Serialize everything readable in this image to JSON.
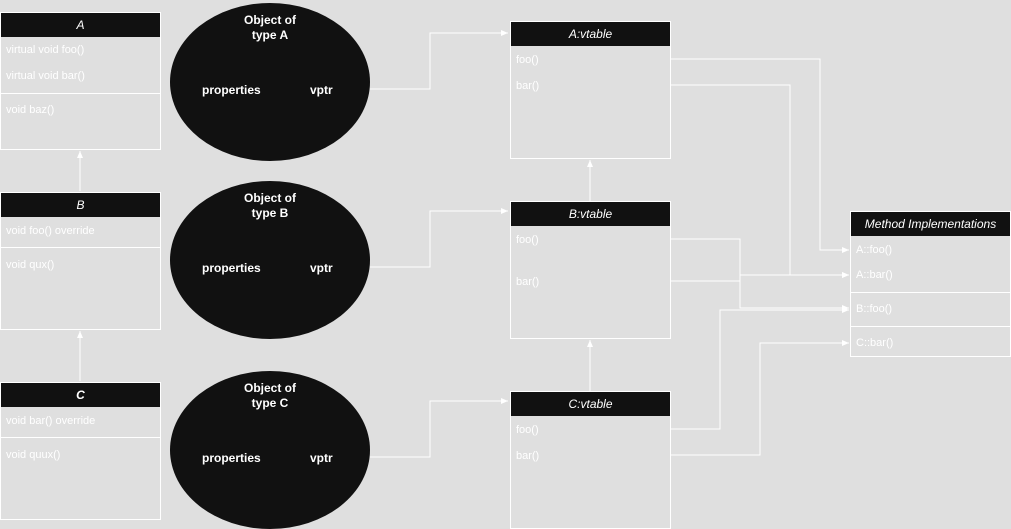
{
  "classes": {
    "A": {
      "name": "A",
      "methods": [
        "virtual void foo()",
        "virtual void bar()"
      ],
      "extra": [
        "void baz()"
      ]
    },
    "B": {
      "name": "B",
      "methods": [
        "void foo() override"
      ],
      "extra": [
        "void qux()"
      ]
    },
    "C": {
      "name": "C",
      "methods": [
        "void bar() override"
      ],
      "extra": [
        "void quux()"
      ]
    }
  },
  "objects": {
    "A": {
      "title_line1": "Object of",
      "title_line2": "type A",
      "properties": "properties",
      "vptr": "vptr"
    },
    "B": {
      "title_line1": "Object of",
      "title_line2": "type B",
      "properties": "properties",
      "vptr": "vptr"
    },
    "C": {
      "title_line1": "Object of",
      "title_line2": "type C",
      "properties": "properties",
      "vptr": "vptr"
    }
  },
  "vtables": {
    "A": {
      "name": "A:vtable",
      "entries": [
        "foo()",
        "bar()"
      ]
    },
    "B": {
      "name": "B:vtable",
      "entries": [
        "foo()",
        "bar()"
      ]
    },
    "C": {
      "name": "C:vtable",
      "entries": [
        "foo()",
        "bar()"
      ]
    }
  },
  "impls": {
    "title": "Method Implementations",
    "entries": [
      "A::foo()",
      "A::bar()",
      "B::foo()",
      "C::bar()"
    ]
  },
  "colors": {
    "background": "#dfdfdf",
    "header": "#111111",
    "line": "#ffffff"
  }
}
